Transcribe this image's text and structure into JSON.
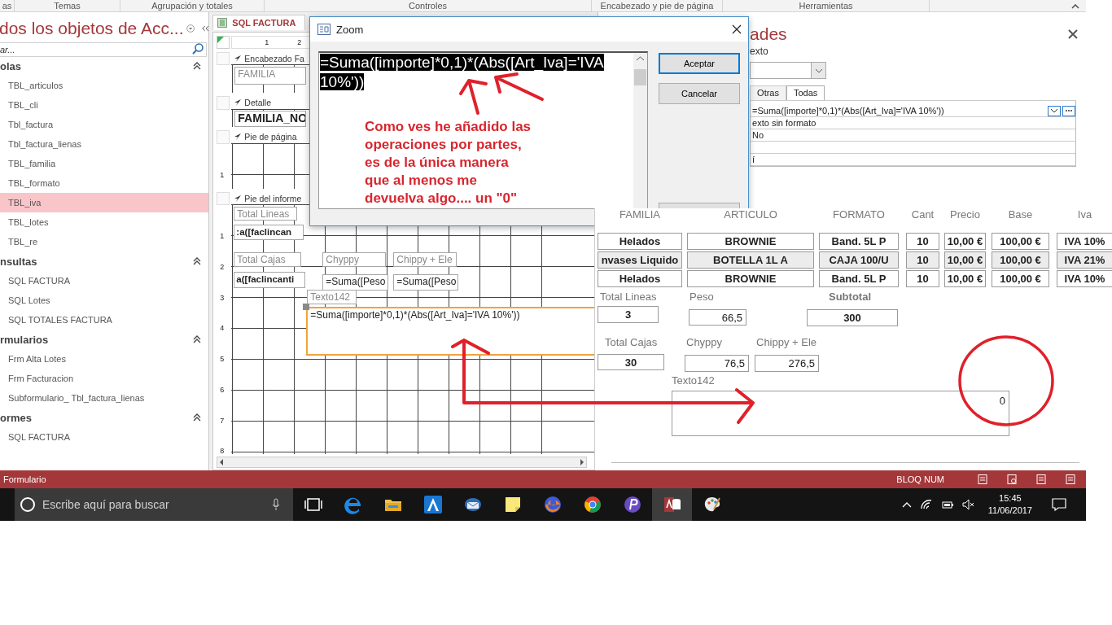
{
  "ribbon": {
    "groups": [
      "as",
      "Temas",
      "Agrupación y totales",
      "Controles",
      "Encabezado y pie de página",
      "Herramientas"
    ]
  },
  "nav": {
    "title": "dos los objetos de Acc...",
    "search": {
      "placeholder": "ar..."
    },
    "groups": [
      {
        "label": "olas",
        "expanded": true,
        "items": [
          {
            "label": "TBL_articulos",
            "selected": false
          },
          {
            "label": "TBL_cli",
            "selected": false
          },
          {
            "label": "Tbl_factura",
            "selected": false
          },
          {
            "label": "Tbl_factura_lienas",
            "selected": false
          },
          {
            "label": "TBL_familia",
            "selected": false
          },
          {
            "label": "TBL_formato",
            "selected": false
          },
          {
            "label": "TBL_iva",
            "selected": true
          },
          {
            "label": "TBL_lotes",
            "selected": false
          },
          {
            "label": "TBL_re",
            "selected": false
          }
        ]
      },
      {
        "label": "nsultas",
        "expanded": true,
        "items": [
          {
            "label": "SQL FACTURA",
            "selected": false
          },
          {
            "label": "SQL Lotes",
            "selected": false
          },
          {
            "label": "SQL TOTALES FACTURA",
            "selected": false
          }
        ]
      },
      {
        "label": "rmularios",
        "expanded": true,
        "items": [
          {
            "label": "Frm Alta Lotes",
            "selected": false
          },
          {
            "label": "Frm Facturacion",
            "selected": false
          },
          {
            "label": "Subformulario_ Tbl_factura_lienas",
            "selected": false
          }
        ]
      },
      {
        "label": "ormes",
        "expanded": true,
        "items": [
          {
            "label": "SQL FACTURA",
            "selected": false
          }
        ]
      }
    ]
  },
  "designer": {
    "tab": "SQL FACTURA",
    "ruler": [
      "1",
      "2"
    ],
    "sections": [
      {
        "label": "Encabezado Fa",
        "controls": [
          {
            "kind": "label",
            "text": "FAMILIA",
            "selected": false
          }
        ]
      },
      {
        "label": "Detalle",
        "controls": [
          {
            "kind": "field",
            "text": "FAMILIA_NO",
            "selected": false
          }
        ]
      },
      {
        "label": "Pie de página",
        "ruler": [
          "1"
        ]
      },
      {
        "label": "Pie del informe",
        "ruler": [
          "1",
          "2",
          "3",
          "4",
          "5",
          "6",
          "7",
          "8"
        ],
        "controls": [
          {
            "kind": "label",
            "text": "Total Lineas",
            "selected": false
          },
          {
            "kind": "field",
            "text": ":a([faclincan",
            "selected": false
          },
          {
            "kind": "label",
            "text": "Total Cajas",
            "selected": false
          },
          {
            "kind": "field",
            "text": "a([faclincanti",
            "selected": false
          },
          {
            "kind": "label",
            "text": "Chyppy",
            "selected": false
          },
          {
            "kind": "field",
            "text": "=Suma([Peso",
            "selected": false
          },
          {
            "kind": "label",
            "text": "Chippy + Ele",
            "selected": false
          },
          {
            "kind": "field",
            "text": "=Suma([Peso",
            "selected": false
          },
          {
            "kind": "label",
            "text": "Texto142",
            "selected": false
          },
          {
            "kind": "field",
            "text": "=Suma([importe]*0,1)*(Abs([Art_Iva]='IVA 10%'))",
            "selected": true
          }
        ]
      }
    ]
  },
  "properties": {
    "title": "ades",
    "subtitle": "exto",
    "tabs": [
      {
        "label": "Otras",
        "selected": false
      },
      {
        "label": "Todas",
        "selected": true
      }
    ],
    "rows": [
      {
        "value": "=Suma([importe]*0,1)*(Abs([Art_Iva]='IVA 10%'))"
      },
      {
        "value": "exto sin formato"
      },
      {
        "value": "No"
      },
      {},
      {
        "value": "í"
      }
    ]
  },
  "zoom_dialog": {
    "title": "Zoom",
    "expression": "=Suma([importe]*0,1)*(Abs([Art_Iva]='IVA 10%'))",
    "expression_selected": true,
    "buttons": [
      {
        "label": "Aceptar",
        "default": true
      },
      {
        "label": "Cancelar",
        "default": false
      }
    ],
    "annotation": "Como ves he añadido las\noperaciones por partes,\nes de la única manera\nque al menos me\ndevuelva algo.... un \"0\""
  },
  "form_view": {
    "columns": [
      "FAMILIA",
      "ARTICULO",
      "FORMATO",
      "Cant",
      "Precio",
      "Base",
      "Iva"
    ],
    "rows": [
      {
        "selected": false,
        "cells": [
          "Helados",
          "BROWNIE",
          "Band. 5L P",
          "10",
          "10,00 €",
          "100,00 €",
          "IVA 10%"
        ]
      },
      {
        "selected": true,
        "cells": [
          "nvases Liquido",
          "BOTELLA 1L A",
          "CAJA 100/U",
          "10",
          "10,00 €",
          "100,00 €",
          "IVA 21%"
        ]
      },
      {
        "selected": false,
        "cells": [
          "Helados",
          "BROWNIE",
          "Band. 5L P",
          "10",
          "10,00 €",
          "100,00 €",
          "IVA 10%"
        ]
      }
    ],
    "totals": [
      {
        "label": "Total Lineas",
        "value": "3"
      },
      {
        "label": "Peso",
        "value": "66,5"
      },
      {
        "label": "Subtotal",
        "value": "300"
      },
      {
        "label": "Total Cajas",
        "value": "30"
      },
      {
        "label": "Chyppy",
        "value": "76,5"
      },
      {
        "label": "Chippy + Ele",
        "value": "276,5"
      },
      {
        "label": "Texto142",
        "value": "0"
      }
    ]
  },
  "status_bar": {
    "mode": "Formulario",
    "indicator": "BLOQ NUM"
  },
  "taskbar": {
    "search": {
      "placeholder": "Escribe aquí para buscar"
    },
    "apps": [
      {
        "kind": "task-view",
        "active": false
      },
      {
        "kind": "browser",
        "active": false
      },
      {
        "kind": "folder",
        "active": false
      },
      {
        "kind": "triangle",
        "active": false
      },
      {
        "kind": "envelope",
        "active": false
      },
      {
        "kind": "note",
        "active": false
      },
      {
        "kind": "fox",
        "active": false
      },
      {
        "kind": "wheel",
        "active": false
      },
      {
        "kind": "circle",
        "active": false
      },
      {
        "kind": "database",
        "active": true
      },
      {
        "kind": "palette",
        "active": false
      }
    ],
    "time": "15:45",
    "date": "11/06/2017"
  }
}
